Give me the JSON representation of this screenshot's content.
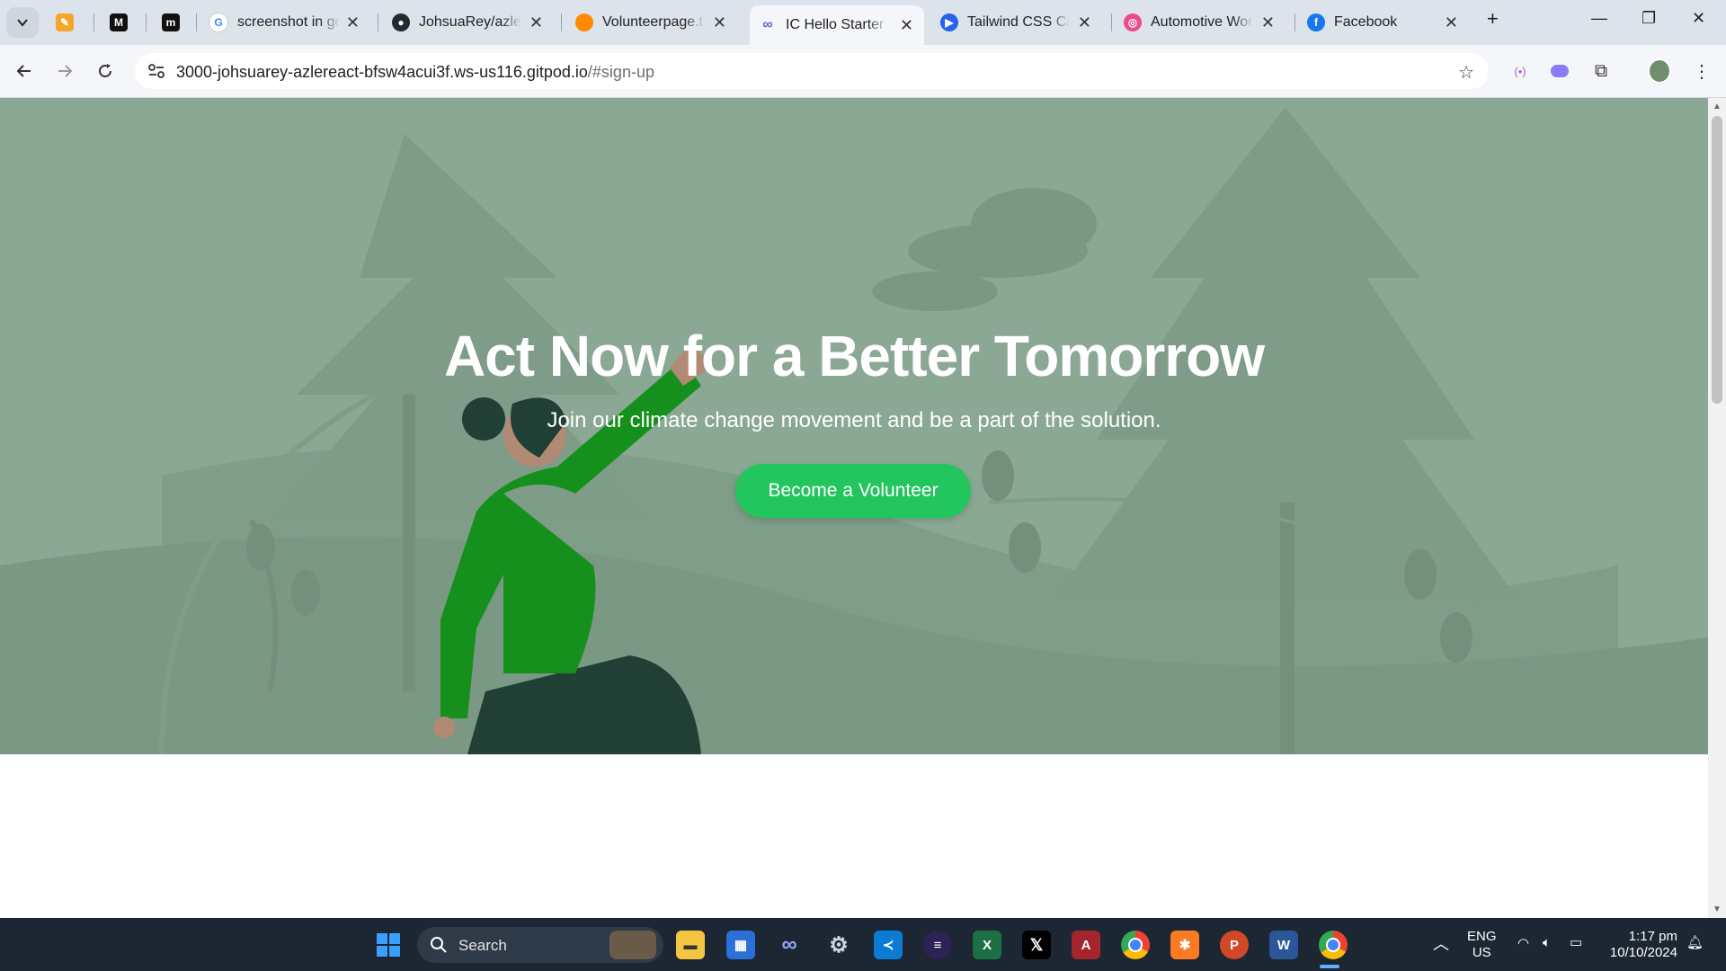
{
  "browser": {
    "tabs": [
      {
        "title": "",
        "icon": "pencil-app-icon",
        "color": "#f4a62a"
      },
      {
        "title": "",
        "icon": "m-logo-icon",
        "color": "#111111"
      },
      {
        "title": "",
        "icon": "medium-icon",
        "color": "#111111"
      },
      {
        "title": "screenshot in goo",
        "icon": "google-icon",
        "color": "#4285f4"
      },
      {
        "title": "JohsuaRey/azle-r",
        "icon": "github-icon",
        "color": "#24292f"
      },
      {
        "title": "Volunteerpage.tsx",
        "icon": "gitpod-icon",
        "color": "#ff8a00"
      },
      {
        "title": "IC Hello Starter",
        "icon": "infinity-icon",
        "color": "#6b5bd6",
        "active": true
      },
      {
        "title": "Tailwind CSS Card",
        "icon": "play-icon",
        "color": "#2563eb"
      },
      {
        "title": "Automotive Work",
        "icon": "dribbble-icon",
        "color": "#ea4c89"
      },
      {
        "title": "Facebook",
        "icon": "facebook-icon",
        "color": "#1877f2"
      }
    ],
    "url_main": "3000-johsuarey-azlereact-bfsw4acui3f.ws-us116.gitpod.io",
    "url_path": "/#sign-up"
  },
  "hero": {
    "title": "Act Now for a Better Tomorrow",
    "subtitle": "Join our climate change movement and be a part of the solution.",
    "cta_label": "Become a Volunteer",
    "bg_color": "#8aa894",
    "cta_color": "#22c55e"
  },
  "taskbar": {
    "search_label": "Search",
    "apps": [
      "start-icon",
      "file-explorer-icon",
      "store-icon",
      "infinity-app-icon",
      "settings-icon",
      "vscode-icon",
      "eclipse-icon",
      "excel-icon",
      "x-icon",
      "access-icon",
      "chrome-icon",
      "xampp-icon",
      "powerpoint-icon",
      "word-icon",
      "chrome-active-icon"
    ],
    "lang_line1": "ENG",
    "lang_line2": "US",
    "time": "1:17 pm",
    "date": "10/10/2024"
  }
}
